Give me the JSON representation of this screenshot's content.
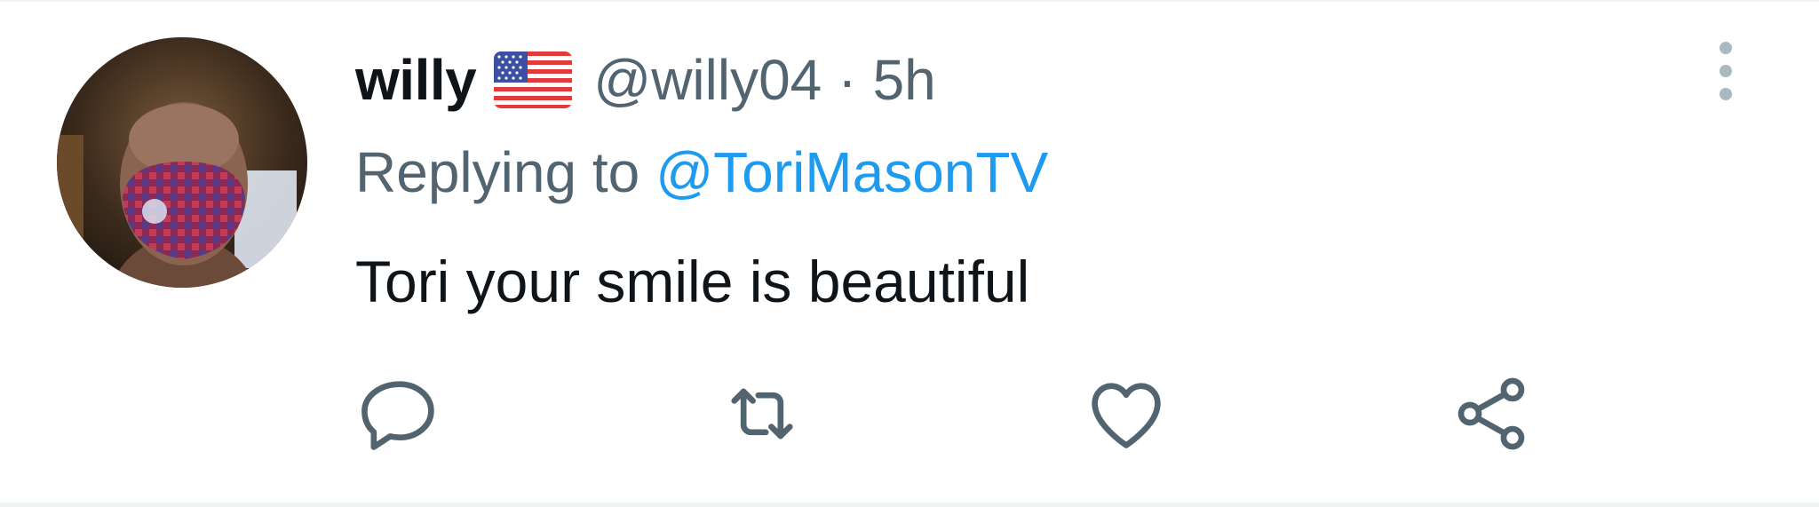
{
  "tweet": {
    "author_name": "willy",
    "author_flag": "us-flag-emoji",
    "author_handle": "@willy04",
    "separator": "·",
    "timestamp": "5h",
    "reply_prefix": "Replying to",
    "reply_mention": "@ToriMasonTV",
    "text": "Tori your smile is beautiful"
  },
  "icons": {
    "more": "more-vertical-icon",
    "reply": "reply-icon",
    "retweet": "retweet-icon",
    "like": "heart-icon",
    "share": "share-icon"
  },
  "colors": {
    "text_primary": "#0f1419",
    "text_secondary": "#536471",
    "accent": "#1d9bf0",
    "icon": "#536471",
    "divider": "#eff3f4"
  }
}
